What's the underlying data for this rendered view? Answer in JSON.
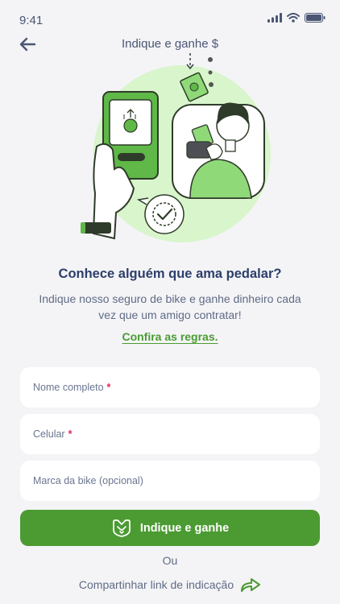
{
  "status_bar": {
    "time": "9:41"
  },
  "header": {
    "title": "Indique e ganhe $"
  },
  "content": {
    "headline": "Conhece alguém que ama pedalar?",
    "subtitle": "Indique nosso seguro de bike e ganhe dinheiro cada vez que um amigo contratar!",
    "rules_link": "Confira as regras."
  },
  "form": {
    "name_placeholder": "Nome completo",
    "phone_placeholder": "Celular",
    "brand_placeholder": "Marca da bike (opcional)",
    "required_mark": "*"
  },
  "actions": {
    "primary_label": "Indique e ganhe",
    "or_label": "Ou",
    "share_label": "Compartinhar link de indicação"
  },
  "colors": {
    "accent": "#4b9b32",
    "background": "#f4f4f6",
    "headline": "#2d3e6b",
    "required": "#e0245e"
  },
  "icons": {
    "back": "arrow-left-icon",
    "primary": "handshake-icon",
    "share": "share-arrow-icon"
  }
}
